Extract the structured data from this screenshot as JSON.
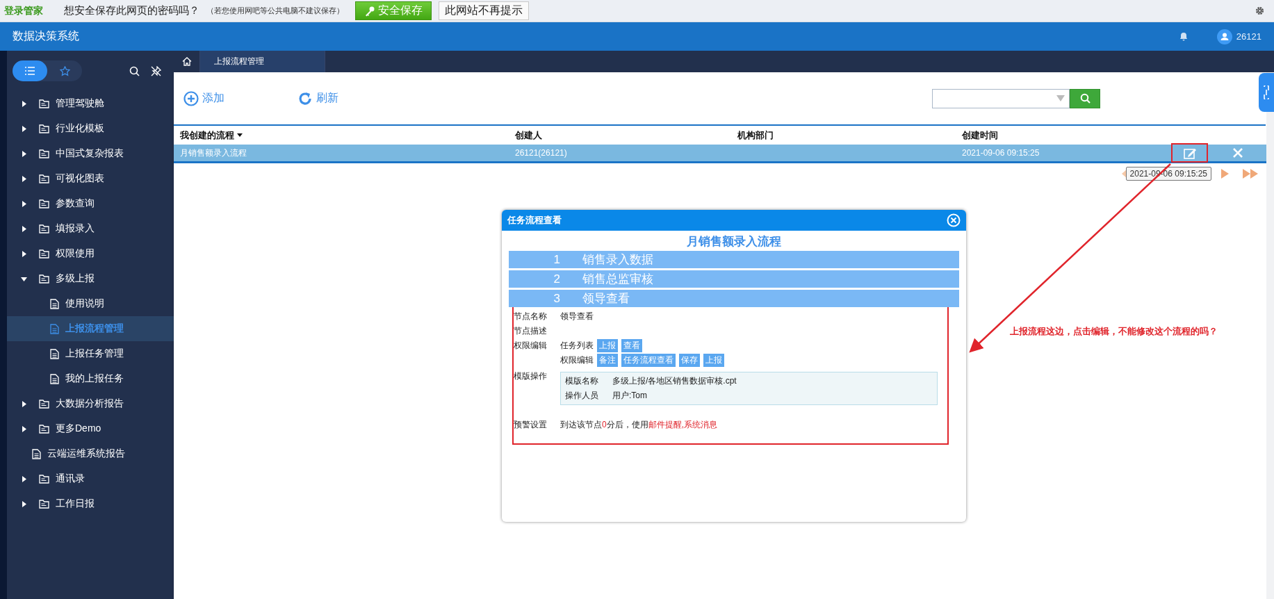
{
  "password_bar": {
    "brand": "登录管家",
    "question": "想安全保存此网页的密码吗？",
    "note": "（若您使用网吧等公共电脑不建议保存）",
    "save_button": "安全保存",
    "dismiss_button": "此网站不再提示"
  },
  "header": {
    "title": "数据决策系统",
    "user": "26121"
  },
  "sidebar": {
    "modes": [
      {
        "kind": "list",
        "selected": true
      },
      {
        "kind": "favorite",
        "selected": false
      }
    ],
    "items": [
      {
        "kind": "folder",
        "label": "管理驾驶舱",
        "expanded": false,
        "selected": false
      },
      {
        "kind": "folder",
        "label": "行业化模板",
        "expanded": false,
        "selected": false
      },
      {
        "kind": "folder",
        "label": "中国式复杂报表",
        "expanded": false,
        "selected": false
      },
      {
        "kind": "folder",
        "label": "可视化图表",
        "expanded": false,
        "selected": false
      },
      {
        "kind": "folder",
        "label": "参数查询",
        "expanded": false,
        "selected": false
      },
      {
        "kind": "folder",
        "label": "填报录入",
        "expanded": false,
        "selected": false
      },
      {
        "kind": "folder",
        "label": "权限使用",
        "expanded": false,
        "selected": false
      },
      {
        "kind": "folder",
        "label": "多级上报",
        "expanded": true,
        "selected": false,
        "children": [
          {
            "kind": "file",
            "label": "使用说明",
            "selected": false
          },
          {
            "kind": "file",
            "label": "上报流程管理",
            "selected": true
          },
          {
            "kind": "file",
            "label": "上报任务管理",
            "selected": false
          },
          {
            "kind": "file",
            "label": "我的上报任务",
            "selected": false
          }
        ]
      },
      {
        "kind": "folder",
        "label": "大数据分析报告",
        "expanded": false,
        "selected": false
      },
      {
        "kind": "folder",
        "label": "更多Demo",
        "expanded": false,
        "selected": false
      },
      {
        "kind": "file",
        "label": "云端运维系统报告",
        "selected": false
      },
      {
        "kind": "folder",
        "label": "通讯录",
        "expanded": false,
        "selected": false
      },
      {
        "kind": "folder",
        "label": "工作日报",
        "expanded": false,
        "selected": false
      }
    ]
  },
  "tabs": [
    {
      "label": "上报流程管理",
      "selected": true
    }
  ],
  "toolbar": {
    "add": "添加",
    "refresh": "刷新"
  },
  "table": {
    "columns": [
      "我创建的流程",
      "创建人",
      "机构部门",
      "创建时间"
    ],
    "rows": [
      {
        "name": "月销售额录入流程",
        "creator": "26121(26121)",
        "time": "2021-09-06 09:15:25",
        "selected": true
      }
    ]
  },
  "pager": {
    "tooltip": "2021-09-06 09:15:25"
  },
  "dialog": {
    "title": "任务流程查看",
    "heading": "月销售额录入流程",
    "steps": [
      {
        "number": "1",
        "label": "销售录入数据"
      },
      {
        "number": "2",
        "label": "销售总监审核"
      },
      {
        "number": "3",
        "label": "领导查看"
      }
    ],
    "node_name": {
      "label": "节点名称",
      "value": "领导查看"
    },
    "node_desc": {
      "label": "节点描述"
    },
    "permissions": {
      "label": "权限编辑",
      "groups": [
        {
          "label": "任务列表",
          "tags": [
            "上报",
            "查看"
          ]
        },
        {
          "label": "权限编辑",
          "tags": [
            "备注",
            "任务流程查看",
            "保存",
            "上报"
          ]
        }
      ]
    },
    "template": {
      "label": "模版操作",
      "rows": [
        {
          "label": "模版名称",
          "value": "多级上报/各地区销售数据审核.cpt"
        },
        {
          "label": "操作人员",
          "value": "用户:Tom"
        }
      ]
    },
    "alert": {
      "label": "预警设置",
      "segments": [
        {
          "text": "到达该节点",
          "highlight": false
        },
        {
          "text": "0",
          "highlight": true
        },
        {
          "text": "分后，使用",
          "highlight": false
        },
        {
          "text": "邮件提醒,系统消息",
          "highlight": true
        }
      ]
    }
  },
  "annotation": "上报流程这边，点击编辑，不能修改这个流程的吗？"
}
